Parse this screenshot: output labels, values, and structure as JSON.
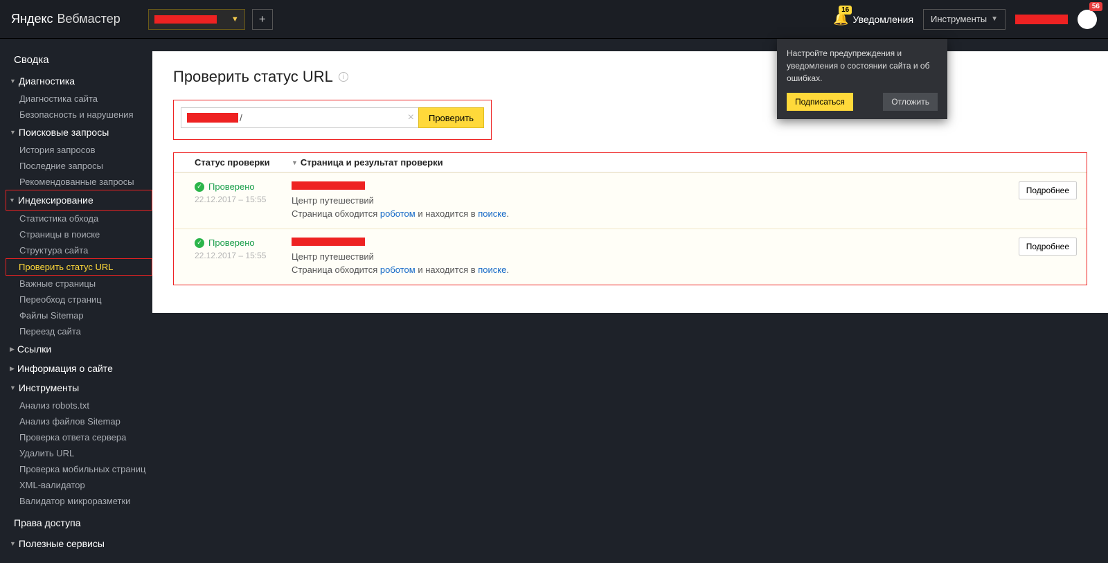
{
  "header": {
    "logo1": "Яндекс",
    "logo2": "Вебмастер",
    "notif_badge": "16",
    "notif_label": "Уведомления",
    "tools_label": "Инструменты",
    "avatar_badge": "56"
  },
  "popup": {
    "text": "Настройте предупреждения и уведомления о состоянии сайта и об ошибках.",
    "subscribe": "Подписаться",
    "postpone": "Отложить"
  },
  "sidebar": {
    "summary": "Сводка",
    "diag": "Диагностика",
    "diag_items": [
      "Диагностика сайта",
      "Безопасность и нарушения"
    ],
    "search": "Поисковые запросы",
    "search_items": [
      "История запросов",
      "Последние запросы",
      "Рекомендованные запросы"
    ],
    "index": "Индексирование",
    "index_items": [
      "Статистика обхода",
      "Страницы в поиске",
      "Структура сайта",
      "Проверить статус URL",
      "Важные страницы",
      "Переобход страниц",
      "Файлы Sitemap",
      "Переезд сайта"
    ],
    "links": "Ссылки",
    "info": "Информация о сайте",
    "tools": "Инструменты",
    "tools_items": [
      "Анализ robots.txt",
      "Анализ файлов Sitemap",
      "Проверка ответа сервера",
      "Удалить URL",
      "Проверка мобильных страниц",
      "XML-валидатор",
      "Валидатор микроразметки"
    ],
    "access": "Права доступа",
    "services": "Полезные сервисы"
  },
  "page": {
    "title": "Проверить статус URL",
    "url_suffix": "/",
    "check_btn": "Проверить",
    "col_status": "Статус проверки",
    "col_page": "Страница и результат проверки",
    "rows": [
      {
        "status": "Проверено",
        "ts": "22.12.2017 – 15:55",
        "desc": "Центр путешествий",
        "crawl_pre": "Страница обходится ",
        "crawl_link1": "роботом",
        "crawl_mid": " и находится в ",
        "crawl_link2": "поиске",
        "more": "Подробнее"
      },
      {
        "status": "Проверено",
        "ts": "22.12.2017 – 15:55",
        "desc": "Центр путешествий",
        "crawl_pre": "Страница обходится ",
        "crawl_link1": "роботом",
        "crawl_mid": " и находится в ",
        "crawl_link2": "поиске",
        "more": "Подробнее"
      }
    ]
  }
}
